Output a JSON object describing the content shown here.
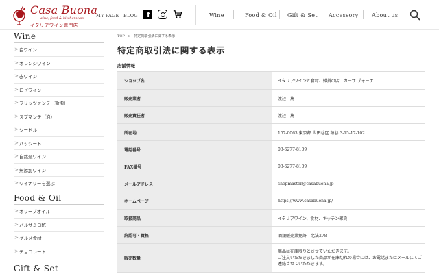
{
  "header": {
    "logo_name": "Casa Buona",
    "logo_tagline": "wine, food & kitchenware",
    "logo_sub": "イタリアワイン専門店",
    "mypage_label": "MY PAGE",
    "blog_label": "BLOG",
    "facebook_glyph": "f",
    "nav": [
      "Wine",
      "Food & Oil",
      "Gift & Set",
      "Accessory",
      "About us"
    ]
  },
  "sidebar": {
    "wine_heading": "Wine",
    "wine_items": [
      "白ワイン",
      "オレンジワイン",
      "赤ワイン",
      "ロゼワイン",
      "フリッツァンテ（微泡）",
      "スプマンテ（泡）",
      "シードル",
      "パッシート",
      "自然派ワイン",
      "無添加ワイン",
      "ワイナリーを選ぶ"
    ],
    "food_heading": "Food & Oil",
    "food_items": [
      "オリーブオイル",
      "バルサミコ酢",
      "グルメ食材",
      "チョコレート"
    ],
    "gift_heading": "Gift & Set"
  },
  "breadcrumb": {
    "top": "TOP",
    "separator": ">",
    "current": "特定商取引法に関する表示"
  },
  "page_title": "特定商取引法に関する表示",
  "section_heading": "店舗情報",
  "table": {
    "rows": [
      {
        "label": "ショップ名",
        "value": "イタリアワインと食材、雑貨の店　カーサ ブォーナ"
      },
      {
        "label": "販売業者",
        "value": "渡辺　篤"
      },
      {
        "label": "販売責任者",
        "value": "渡辺　篤"
      },
      {
        "label": "所在地",
        "value": "157-0063 東京都 世田谷区 粕谷 3-15-17-102"
      },
      {
        "label": "電話番号",
        "value": "03-6277-8109"
      },
      {
        "label": "FAX番号",
        "value": "03-6277-8109"
      },
      {
        "label": "メールアドレス",
        "value": "shopmaster@casabuona.jp"
      },
      {
        "label": "ホームページ",
        "value": "https://www.casabuona.jp/"
      },
      {
        "label": "取扱商品",
        "value": "イタリアワイン、食材、キッチン雑貨"
      },
      {
        "label": "許認可・資格",
        "value": "酒類販売業免許　北法278"
      },
      {
        "label": "販売数量",
        "value_lines": [
          "商品は在庫限りとさせていただきます。",
          "ご注文いただきました商品が在庫切れの場合には、お電話またはメールにてご連絡させていただきます。"
        ]
      }
    ]
  },
  "colors": {
    "brand_red": "#a8161c",
    "table_header_bg": "#ececec"
  }
}
